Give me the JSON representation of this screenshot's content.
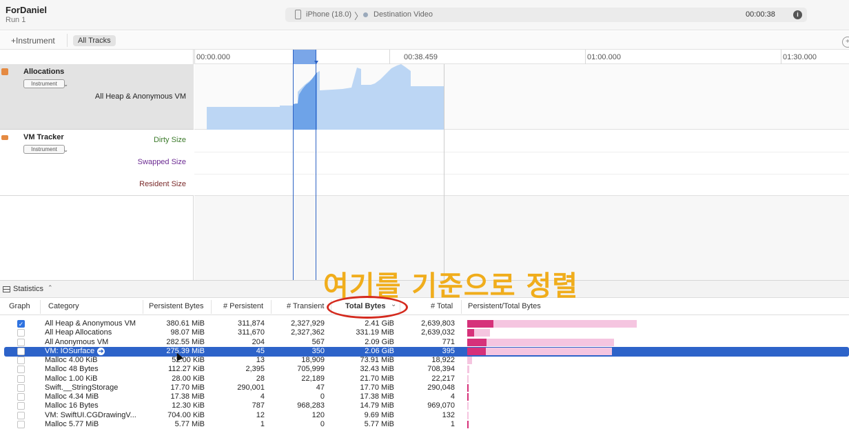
{
  "window": {
    "title": "ForDaniel",
    "subtitle": "Run 1"
  },
  "device_bar": {
    "device": "iPhone (18.0)",
    "separator": "〉",
    "target": "Destination Video",
    "elapsed": "00:00:38"
  },
  "toolbar": {
    "add_instrument": "+Instrument",
    "all_tracks": "All Tracks"
  },
  "ruler": {
    "ticks": [
      "00:00.000",
      "00:38.459",
      "01:00.000",
      "01:30.000"
    ]
  },
  "tracks": [
    {
      "name": "Allocations",
      "badge": "Instrument",
      "series": [
        "All Heap & Anonymous VM"
      ]
    },
    {
      "name": "VM Tracker",
      "badge": "Instrument",
      "series": [
        "Dirty Size",
        "Swapped Size",
        "Resident Size"
      ]
    }
  ],
  "colors": {
    "accent": "#2d63c9",
    "graph_fill": "#bcd6f4",
    "graph_selected": "#6ea3e8",
    "dirty": "#3b7a2a",
    "swapped": "#6b2a92",
    "resident": "#7a2a2a",
    "annotation": "#f0ad1c",
    "bar_strong": "#d6317a",
    "bar_light": "#f5c5e0"
  },
  "statistics": {
    "label": "Statistics",
    "chevron": "⌃"
  },
  "annotation": {
    "text": "여기를 기준으로 정렬"
  },
  "columns": {
    "graph": "Graph",
    "category": "Category",
    "persistent_bytes": "Persistent Bytes",
    "persistent": "# Persistent",
    "transient": "# Transient",
    "total_bytes": "Total Bytes",
    "sort_indicator": "⌄",
    "total": "# Total",
    "ratio": "Persistent/Total Bytes"
  },
  "rows": [
    {
      "checked": true,
      "category": "All Heap & Anonymous VM",
      "pbytes": "380.61 MiB",
      "persistent": "311,874",
      "transient": "2,327,929",
      "tbytes": "2.41 GiB",
      "total": "2,639,803",
      "persist_frac": 0.155,
      "total_frac": 1.0
    },
    {
      "checked": false,
      "category": "All Heap Allocations",
      "pbytes": "98.07 MiB",
      "persistent": "311,670",
      "transient": "2,327,362",
      "tbytes": "331.19 MiB",
      "total": "2,639,032",
      "persist_frac": 0.04,
      "total_frac": 0.134
    },
    {
      "checked": false,
      "category": "All Anonymous VM",
      "pbytes": "282.55 MiB",
      "persistent": "204",
      "transient": "567",
      "tbytes": "2.09 GiB",
      "total": "771",
      "persist_frac": 0.114,
      "total_frac": 0.867
    },
    {
      "checked": false,
      "category": "VM: IOSurface",
      "pbytes": "275.39 MiB",
      "persistent": "45",
      "transient": "350",
      "tbytes": "2.06 GiB",
      "total": "395",
      "persist_frac": 0.111,
      "total_frac": 0.855,
      "selected": true
    },
    {
      "checked": false,
      "category": "Malloc 4.00 KiB",
      "pbytes": "52.00 KiB",
      "persistent": "13",
      "transient": "18,909",
      "tbytes": "73.91 MiB",
      "total": "18,922",
      "persist_frac": 0.0,
      "total_frac": 0.03
    },
    {
      "checked": false,
      "category": "Malloc 48 Bytes",
      "pbytes": "112.27 KiB",
      "persistent": "2,395",
      "transient": "705,999",
      "tbytes": "32.43 MiB",
      "total": "708,394",
      "persist_frac": 0.0,
      "total_frac": 0.013
    },
    {
      "checked": false,
      "category": "Malloc 1.00 KiB",
      "pbytes": "28.00 KiB",
      "persistent": "28",
      "transient": "22,189",
      "tbytes": "21.70 MiB",
      "total": "22,217",
      "persist_frac": 0.0,
      "total_frac": 0.009
    },
    {
      "checked": false,
      "category": "Swift.__StringStorage",
      "pbytes": "17.70 MiB",
      "persistent": "290,001",
      "transient": "47",
      "tbytes": "17.70 MiB",
      "total": "290,048",
      "persist_frac": 0.007,
      "total_frac": 0.007
    },
    {
      "checked": false,
      "category": "Malloc 4.34 MiB",
      "pbytes": "17.38 MiB",
      "persistent": "4",
      "transient": "0",
      "tbytes": "17.38 MiB",
      "total": "4",
      "persist_frac": 0.007,
      "total_frac": 0.007
    },
    {
      "checked": false,
      "category": "Malloc 16 Bytes",
      "pbytes": "12.30 KiB",
      "persistent": "787",
      "transient": "968,283",
      "tbytes": "14.79 MiB",
      "total": "969,070",
      "persist_frac": 0.0,
      "total_frac": 0.006
    },
    {
      "checked": false,
      "category": "VM: SwiftUI.CGDrawingV...",
      "pbytes": "704.00 KiB",
      "persistent": "12",
      "transient": "120",
      "tbytes": "9.69 MiB",
      "total": "132",
      "persist_frac": 0.0,
      "total_frac": 0.004
    },
    {
      "checked": false,
      "category": "Malloc 5.77 MiB",
      "pbytes": "5.77 MiB",
      "persistent": "1",
      "transient": "0",
      "tbytes": "5.77 MiB",
      "total": "1",
      "persist_frac": 0.002,
      "total_frac": 0.002
    }
  ]
}
